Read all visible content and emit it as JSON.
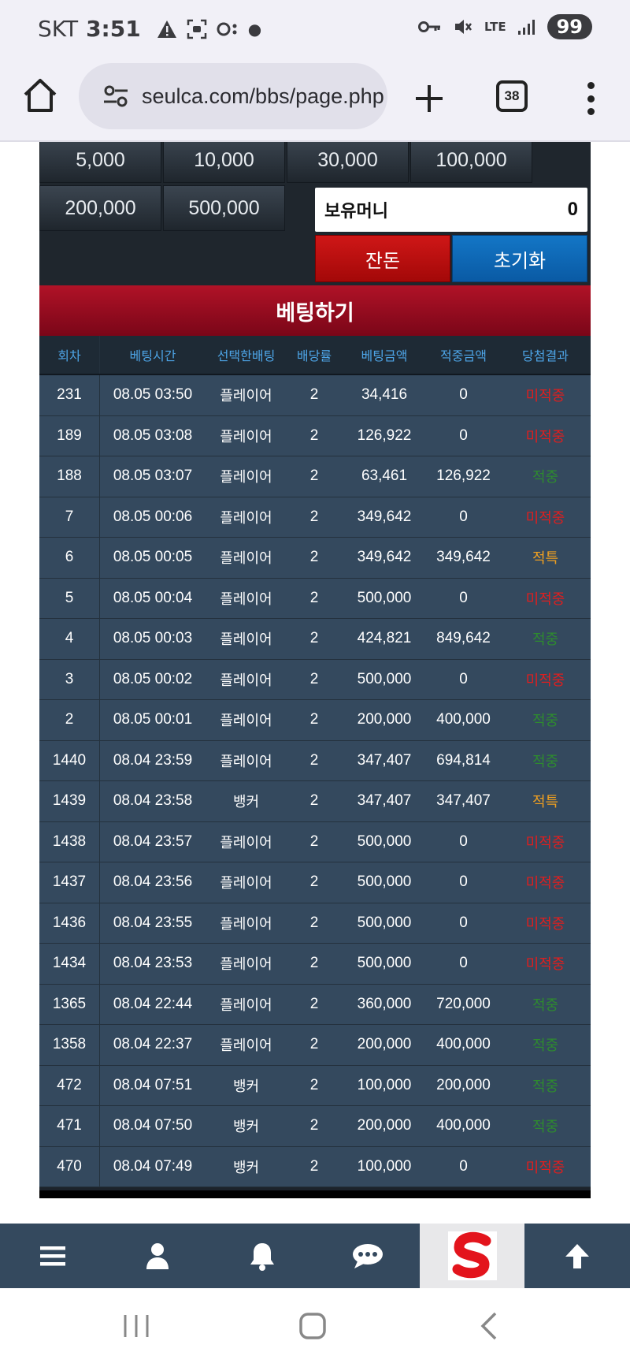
{
  "status_bar": {
    "carrier": "SKT",
    "time": "3:51",
    "battery": "99",
    "network": "LTE"
  },
  "browser": {
    "url": "seulca.com/bbs/page.php",
    "tab_count": "38"
  },
  "amounts": [
    "5,000",
    "10,000",
    "30,000",
    "100,000",
    "200,000",
    "500,000"
  ],
  "money": {
    "label": "보유머니",
    "value": "0"
  },
  "buttons": {
    "change": "잔돈",
    "reset": "초기화",
    "bet_title": "베팅하기"
  },
  "table": {
    "headers": [
      "회차",
      "베팅시간",
      "선택한배팅",
      "배당률",
      "베팅금액",
      "적중금액",
      "당첨결과"
    ],
    "rows": [
      {
        "round": "231",
        "time": "08.05 03:50",
        "pick": "플레이어",
        "odds": "2",
        "bet": "34,416",
        "win": "0",
        "result": "미적중",
        "type": "miss"
      },
      {
        "round": "189",
        "time": "08.05 03:08",
        "pick": "플레이어",
        "odds": "2",
        "bet": "126,922",
        "win": "0",
        "result": "미적중",
        "type": "miss"
      },
      {
        "round": "188",
        "time": "08.05 03:07",
        "pick": "플레이어",
        "odds": "2",
        "bet": "63,461",
        "win": "126,922",
        "result": "적중",
        "type": "hit"
      },
      {
        "round": "7",
        "time": "08.05 00:06",
        "pick": "플레이어",
        "odds": "2",
        "bet": "349,642",
        "win": "0",
        "result": "미적중",
        "type": "miss"
      },
      {
        "round": "6",
        "time": "08.05 00:05",
        "pick": "플레이어",
        "odds": "2",
        "bet": "349,642",
        "win": "349,642",
        "result": "적특",
        "type": "special"
      },
      {
        "round": "5",
        "time": "08.05 00:04",
        "pick": "플레이어",
        "odds": "2",
        "bet": "500,000",
        "win": "0",
        "result": "미적중",
        "type": "miss"
      },
      {
        "round": "4",
        "time": "08.05 00:03",
        "pick": "플레이어",
        "odds": "2",
        "bet": "424,821",
        "win": "849,642",
        "result": "적중",
        "type": "hit"
      },
      {
        "round": "3",
        "time": "08.05 00:02",
        "pick": "플레이어",
        "odds": "2",
        "bet": "500,000",
        "win": "0",
        "result": "미적중",
        "type": "miss"
      },
      {
        "round": "2",
        "time": "08.05 00:01",
        "pick": "플레이어",
        "odds": "2",
        "bet": "200,000",
        "win": "400,000",
        "result": "적중",
        "type": "hit"
      },
      {
        "round": "1440",
        "time": "08.04 23:59",
        "pick": "플레이어",
        "odds": "2",
        "bet": "347,407",
        "win": "694,814",
        "result": "적중",
        "type": "hit"
      },
      {
        "round": "1439",
        "time": "08.04 23:58",
        "pick": "뱅커",
        "odds": "2",
        "bet": "347,407",
        "win": "347,407",
        "result": "적특",
        "type": "special"
      },
      {
        "round": "1438",
        "time": "08.04 23:57",
        "pick": "플레이어",
        "odds": "2",
        "bet": "500,000",
        "win": "0",
        "result": "미적중",
        "type": "miss"
      },
      {
        "round": "1437",
        "time": "08.04 23:56",
        "pick": "플레이어",
        "odds": "2",
        "bet": "500,000",
        "win": "0",
        "result": "미적중",
        "type": "miss"
      },
      {
        "round": "1436",
        "time": "08.04 23:55",
        "pick": "플레이어",
        "odds": "2",
        "bet": "500,000",
        "win": "0",
        "result": "미적중",
        "type": "miss"
      },
      {
        "round": "1434",
        "time": "08.04 23:53",
        "pick": "플레이어",
        "odds": "2",
        "bet": "500,000",
        "win": "0",
        "result": "미적중",
        "type": "miss"
      },
      {
        "round": "1365",
        "time": "08.04 22:44",
        "pick": "플레이어",
        "odds": "2",
        "bet": "360,000",
        "win": "720,000",
        "result": "적중",
        "type": "hit"
      },
      {
        "round": "1358",
        "time": "08.04 22:37",
        "pick": "플레이어",
        "odds": "2",
        "bet": "200,000",
        "win": "400,000",
        "result": "적중",
        "type": "hit"
      },
      {
        "round": "472",
        "time": "08.04 07:51",
        "pick": "뱅커",
        "odds": "2",
        "bet": "100,000",
        "win": "200,000",
        "result": "적중",
        "type": "hit"
      },
      {
        "round": "471",
        "time": "08.04 07:50",
        "pick": "뱅커",
        "odds": "2",
        "bet": "200,000",
        "win": "400,000",
        "result": "적중",
        "type": "hit"
      },
      {
        "round": "470",
        "time": "08.04 07:49",
        "pick": "뱅커",
        "odds": "2",
        "bet": "100,000",
        "win": "0",
        "result": "미적중",
        "type": "miss"
      }
    ]
  },
  "bottom_nav": [
    "menu-icon",
    "user-icon",
    "bell-icon",
    "chat-icon",
    "logo",
    "arrow-up-icon"
  ],
  "colors": {
    "miss": "#e01e1e",
    "hit": "#2e8b2e",
    "special": "#f0a020",
    "header_red": "#b01227",
    "table_bg": "#34495e"
  }
}
